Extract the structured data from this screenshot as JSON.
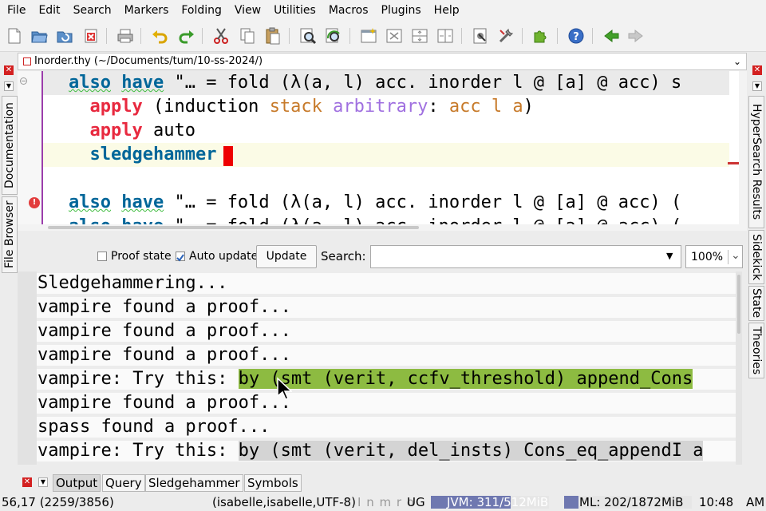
{
  "menubar": [
    "File",
    "Edit",
    "Search",
    "Markers",
    "Folding",
    "View",
    "Utilities",
    "Macros",
    "Plugins",
    "Help"
  ],
  "toolbar": {
    "icons": [
      "new-file-icon",
      "open-file-icon",
      "reload-file-icon",
      "close-file-icon",
      "print-icon",
      "undo-icon",
      "redo-icon",
      "cut-icon",
      "copy-icon",
      "paste-icon",
      "find-icon",
      "find-replace-icon",
      "new-view-icon",
      "unsplit-icon",
      "split-horizontal-icon",
      "split-vertical-icon",
      "buffer-options-icon",
      "global-options-icon",
      "plugin-manager-icon",
      "help-icon",
      "back-icon",
      "forward-icon"
    ]
  },
  "left_dock": {
    "tabs": [
      "Documentation",
      "File Browser"
    ]
  },
  "right_dock": {
    "tabs": [
      "HyperSearch Results",
      "Sidekick",
      "State",
      "Theories"
    ]
  },
  "buffer": {
    "title": "Inorder.thy (~/Documents/tum/10-ss-2024/)"
  },
  "editor": {
    "lines": [
      {
        "indent": "",
        "tokens": [
          {
            "t": "also",
            "c": "kw2 wavy"
          },
          {
            "t": " "
          },
          {
            "t": "have",
            "c": "kw2 wavy"
          },
          {
            "t": " \"… = fold (λ(a, l) acc. inorder l @ [a] @ acc) s"
          }
        ]
      },
      {
        "indent": "  ",
        "tokens": [
          {
            "t": "apply",
            "c": "kw"
          },
          {
            "t": " (induction "
          },
          {
            "t": "stack",
            "c": "var"
          },
          {
            "t": " "
          },
          {
            "t": "arbitrary",
            "c": "skv"
          },
          {
            "t": ": "
          },
          {
            "t": "acc",
            "c": "var"
          },
          {
            "t": " "
          },
          {
            "t": "l",
            "c": "var"
          },
          {
            "t": " "
          },
          {
            "t": "a",
            "c": "var"
          },
          {
            "t": ")"
          }
        ]
      },
      {
        "indent": "  ",
        "tokens": [
          {
            "t": "apply",
            "c": "kw"
          },
          {
            "t": " auto"
          }
        ]
      },
      {
        "indent": "  ",
        "tokens": [
          {
            "t": "sledgehammer",
            "c": "kw2"
          }
        ]
      },
      {
        "indent": "",
        "tokens": []
      },
      {
        "indent": "",
        "tokens": [
          {
            "t": "also",
            "c": "kw2 wavy"
          },
          {
            "t": " "
          },
          {
            "t": "have",
            "c": "kw2 wavy"
          },
          {
            "t": " \"… = fold (λ(a, l) acc. inorder l @ [a] @ acc) ("
          }
        ]
      },
      {
        "indent": "",
        "tokens": [
          {
            "t": "also",
            "c": "kw2"
          },
          {
            "t": " "
          },
          {
            "t": "have",
            "c": "kw2"
          },
          {
            "t": " \"… = fold (λ(a, l) acc. inorder l @ [a] @ acc) ("
          }
        ]
      }
    ]
  },
  "output_controls": {
    "proof_state_label": "Proof state",
    "proof_state_checked": false,
    "auto_update_label": "Auto update",
    "auto_update_checked": true,
    "update_button": "Update",
    "search_label": "Search:",
    "search_value": "",
    "zoom": "100%"
  },
  "output": {
    "lines": [
      {
        "text": "Sledgehammering...",
        "sendback": ""
      },
      {
        "text": "vampire found a proof...",
        "sendback": ""
      },
      {
        "text": "vampire found a proof...",
        "sendback": ""
      },
      {
        "text": "vampire found a proof...",
        "sendback": ""
      },
      {
        "text": "vampire: Try this: ",
        "sendback": "by (smt (verit, ccfv_threshold) append_Cons",
        "active": true
      },
      {
        "text": "vampire found a proof...",
        "sendback": ""
      },
      {
        "text": "spass found a proof...",
        "sendback": ""
      },
      {
        "text": "vampire: Try this: ",
        "sendback": "by (smt (verit, del_insts) Cons_eq_appendI a",
        "active": false
      }
    ]
  },
  "bottom_tabs": [
    {
      "label": "Output",
      "selected": true
    },
    {
      "label": "Query",
      "selected": false
    },
    {
      "label": "Sledgehammer",
      "selected": false
    },
    {
      "label": "Symbols",
      "selected": false
    }
  ],
  "status": {
    "position": "56,17 (2259/3856)",
    "mode": "(isabelle,isabelle,UTF-8)",
    "flags": "I n m r o",
    "ug": "UG",
    "jvm": "JVM: 311/512MiB",
    "ml": "ML: 202/1872MiB",
    "time": "10:48",
    "ampm": "AM"
  },
  "colors": {
    "caret": "#ee0000",
    "keyword_red": "#e8293f",
    "keyword_blue": "#006699",
    "sendback_active": "#8dbb41",
    "gutter_line": "#9b3dab"
  }
}
